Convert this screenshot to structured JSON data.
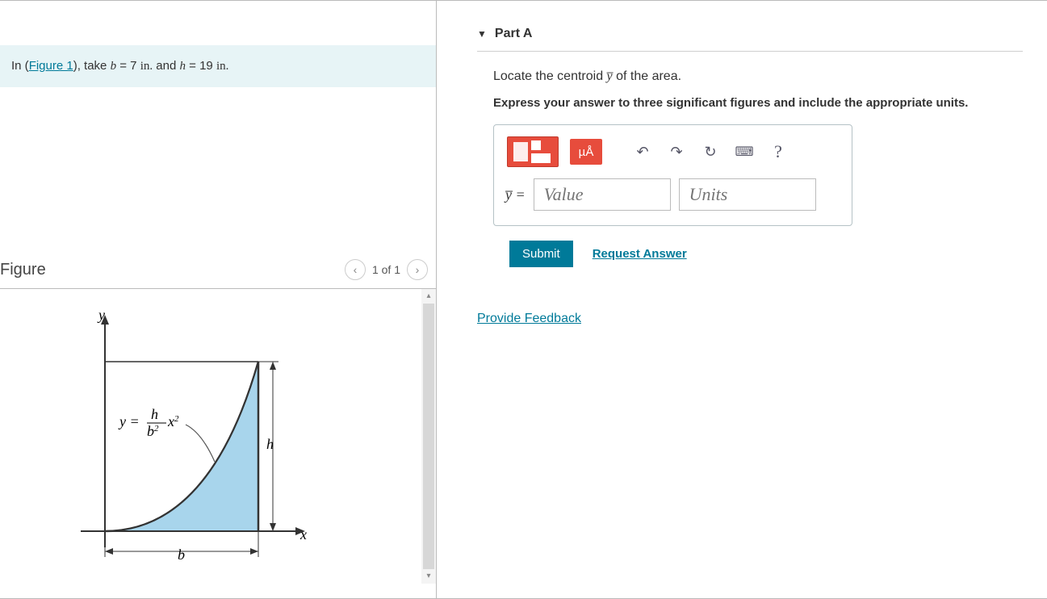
{
  "left": {
    "prompt_prefix": "In (",
    "figure_link": "Figure 1",
    "prompt_mid1": "), take ",
    "var_b": "b",
    "eq_b": " = 7 ",
    "unit_b": "in.",
    "and": " and ",
    "var_h": "h",
    "eq_h": " = 19 ",
    "unit_h": "in.",
    "period": "",
    "figure_title": "Figure",
    "pager": "1 of 1",
    "axis_y": "y",
    "axis_x": "x",
    "dim_h": "h",
    "dim_b": "b",
    "eq_lhs": "y = ",
    "eq_num": "h",
    "eq_den": "b",
    "eq_den_sup": "2",
    "eq_tail": " x",
    "eq_tail_sup": "2"
  },
  "right": {
    "part_label": "Part A",
    "q_before": "Locate the centroid ",
    "q_var": "y̅",
    "q_after": " of the area.",
    "instruction": "Express your answer to three significant figures and include the appropriate units.",
    "toolbar": {
      "units_btn": "µÅ",
      "help": "?"
    },
    "ybar_label": "y̅ =",
    "value_ph": "Value",
    "units_ph": "Units",
    "submit": "Submit",
    "request": "Request Answer",
    "feedback": "Provide Feedback"
  }
}
